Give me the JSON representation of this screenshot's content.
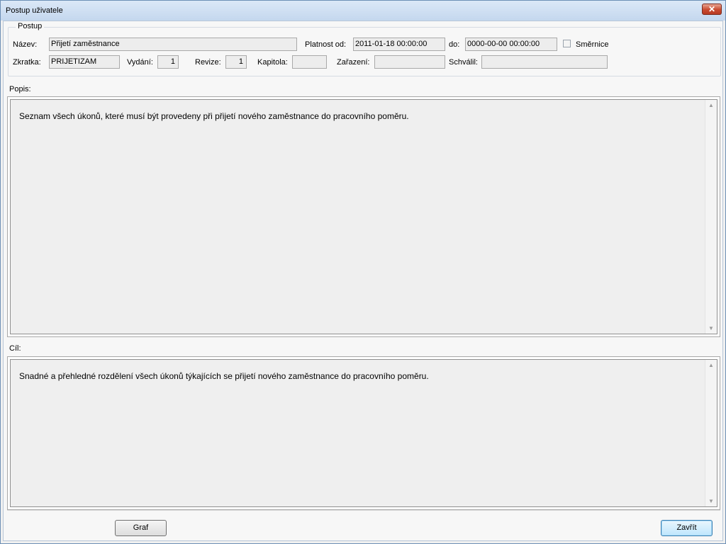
{
  "window": {
    "title": "Postup uživatele",
    "close_glyph": "✕"
  },
  "group": {
    "label": "Postup"
  },
  "fields": {
    "nazev_label": "Název:",
    "nazev_value": "Přijetí zaměstnance",
    "platnost_label": "Platnost od:",
    "platnost_od_value": "2011-01-18 00:00:00",
    "do_label": "do:",
    "platnost_do_value": "0000-00-00 00:00:00",
    "smernice_label": "Směrnice",
    "smernice_checked": false,
    "zkratka_label": "Zkratka:",
    "zkratka_value": "PRIJETIZAM",
    "vydani_label": "Vydání:",
    "vydani_value": "1",
    "revize_label": "Revize:",
    "revize_value": "1",
    "kapitola_label": "Kapitola:",
    "kapitola_value": "",
    "zarazeni_label": "Zařazení:",
    "zarazeni_value": "",
    "schvalil_label": "Schválil:",
    "schvalil_value": ""
  },
  "popis": {
    "label": "Popis:",
    "text": "Seznam všech úkonů, které musí být provedeny při přijetí nového zaměstnance do pracovního poměru."
  },
  "cil": {
    "label": "Cíl:",
    "text": "Snadné a přehledné rozdělení všech úkonů týkajících se přijetí nového zaměstnance do pracovního poměru."
  },
  "buttons": {
    "graf": "Graf",
    "zavrit": "Zavřít"
  },
  "icons": {
    "scroll_up": "▲",
    "scroll_down": "▼"
  }
}
